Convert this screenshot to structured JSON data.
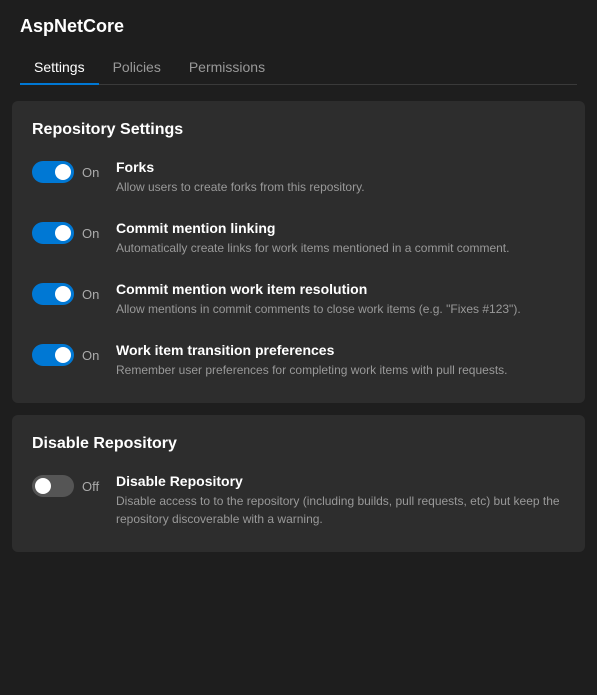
{
  "app": {
    "title": "AspNetCore"
  },
  "tabs": [
    {
      "label": "Settings",
      "active": true
    },
    {
      "label": "Policies",
      "active": false
    },
    {
      "label": "Permissions",
      "active": false
    }
  ],
  "sections": [
    {
      "title": "Repository Settings",
      "settings": [
        {
          "id": "forks",
          "name": "Forks",
          "description": "Allow users to create forks from this repository.",
          "enabled": true,
          "state_label": "On"
        },
        {
          "id": "commit-mention-linking",
          "name": "Commit mention linking",
          "description": "Automatically create links for work items mentioned in a commit comment.",
          "enabled": true,
          "state_label": "On"
        },
        {
          "id": "commit-mention-resolution",
          "name": "Commit mention work item resolution",
          "description": "Allow mentions in commit comments to close work items (e.g. \"Fixes #123\").",
          "enabled": true,
          "state_label": "On"
        },
        {
          "id": "work-item-transition",
          "name": "Work item transition preferences",
          "description": "Remember user preferences for completing work items with pull requests.",
          "enabled": true,
          "state_label": "On"
        }
      ]
    },
    {
      "title": "Disable Repository",
      "settings": [
        {
          "id": "disable-repository",
          "name": "Disable Repository",
          "description": "Disable access to to the repository (including builds, pull requests, etc) but keep the repository discoverable with a warning.",
          "enabled": false,
          "state_label": "Off"
        }
      ]
    }
  ]
}
